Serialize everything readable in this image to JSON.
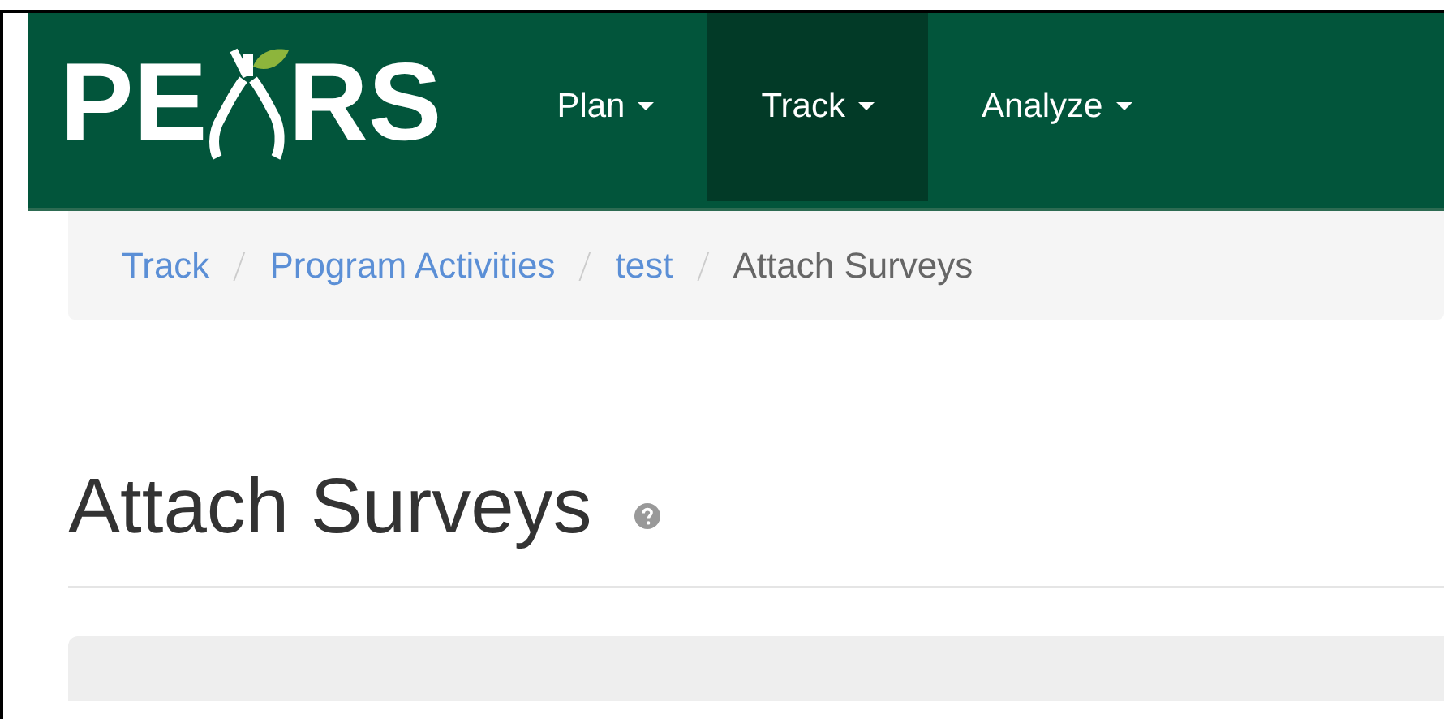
{
  "logo": {
    "left": "PE",
    "right": "RS"
  },
  "nav": [
    {
      "label": "Plan",
      "selected": false
    },
    {
      "label": "Track",
      "selected": true
    },
    {
      "label": "Analyze",
      "selected": false
    }
  ],
  "breadcrumb": [
    {
      "label": "Track",
      "kind": "link"
    },
    {
      "label": "Program Activities",
      "kind": "link"
    },
    {
      "label": "test",
      "kind": "link"
    },
    {
      "label": "Attach Surveys",
      "kind": "current"
    }
  ],
  "heading": "Attach Surveys"
}
